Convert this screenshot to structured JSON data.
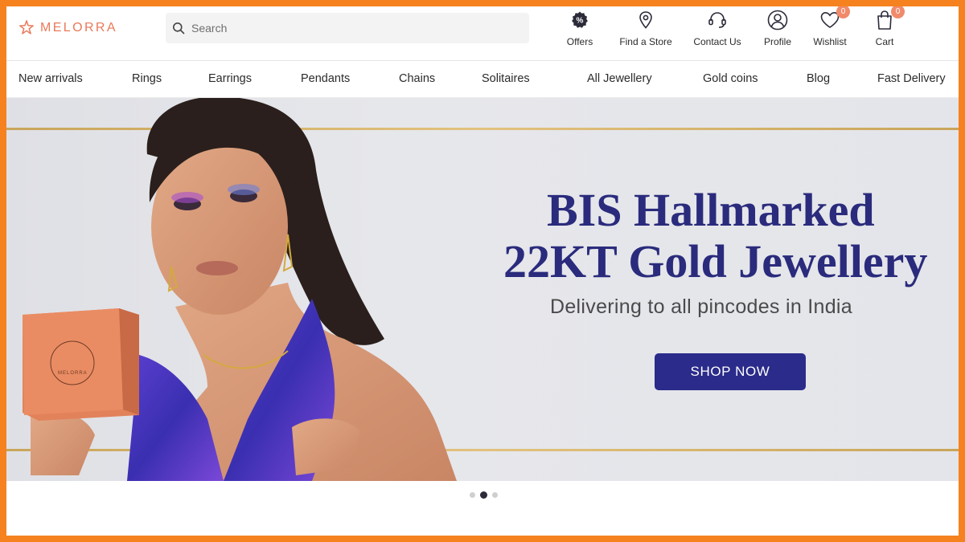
{
  "brand": {
    "name": "MELORRA",
    "accent": "#e9795a"
  },
  "search": {
    "placeholder": "Search"
  },
  "header_actions": [
    {
      "id": "offers",
      "label": "Offers",
      "icon": "percent-icon"
    },
    {
      "id": "store",
      "label": "Find a Store",
      "icon": "location-pin-icon"
    },
    {
      "id": "contact",
      "label": "Contact Us",
      "icon": "headset-icon"
    },
    {
      "id": "profile",
      "label": "Profile",
      "icon": "user-icon"
    },
    {
      "id": "wishlist",
      "label": "Wishlist",
      "icon": "heart-icon",
      "badge": "0"
    },
    {
      "id": "cart",
      "label": "Cart",
      "icon": "bag-icon",
      "badge": "0"
    }
  ],
  "nav": [
    "New arrivals",
    "Rings",
    "Earrings",
    "Pendants",
    "Chains",
    "Solitaires",
    "All Jewellery",
    "Gold coins",
    "Blog",
    "Fast Delivery"
  ],
  "banner": {
    "headline_line1": "BIS Hallmarked",
    "headline_line2": "22KT Gold Jewellery",
    "subline": "Delivering to all pincodes in India",
    "cta": "SHOP NOW",
    "box_text": "MELORRA",
    "headline_color": "#2a2b7c",
    "cta_color": "#2a2b8a"
  },
  "carousel": {
    "count": 3,
    "active": 2
  }
}
